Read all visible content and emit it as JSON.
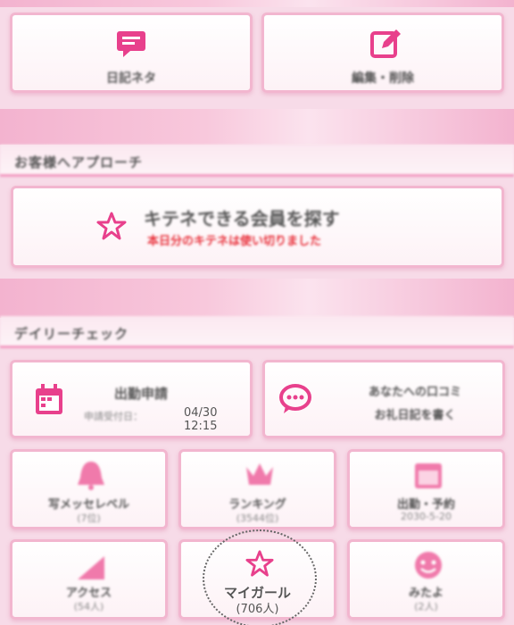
{
  "top_row": {
    "left_label": "日記ネタ",
    "right_label": "編集・削除"
  },
  "approach": {
    "section_title": "お客様へアプローチ",
    "search_title": "キテネできる会員を探す",
    "search_note": "本日分のキテネは使い切りました"
  },
  "daily": {
    "section_title": "デイリーチェック",
    "shift": {
      "title": "出勤申請",
      "note": "申請受付日：",
      "time": "04/30 12:15"
    },
    "review": {
      "line1": "あなたへの口コミ",
      "line2": "お礼日記を書く"
    },
    "grid": [
      {
        "label": "写メッセレベル",
        "sub": "(7位)"
      },
      {
        "label": "ランキング",
        "sub": "(3544位)"
      },
      {
        "label": "出勤・予約",
        "sub": "2030-5-20"
      },
      {
        "label": "アクセス",
        "sub": "(54人)"
      },
      {
        "label": "マイガール",
        "sub": "(706人)"
      },
      {
        "label": "みたよ",
        "sub": "(2人)"
      }
    ]
  },
  "colors": {
    "accent": "#e8408c",
    "border": "#f2b6cf",
    "band": "#f3b3cf"
  }
}
